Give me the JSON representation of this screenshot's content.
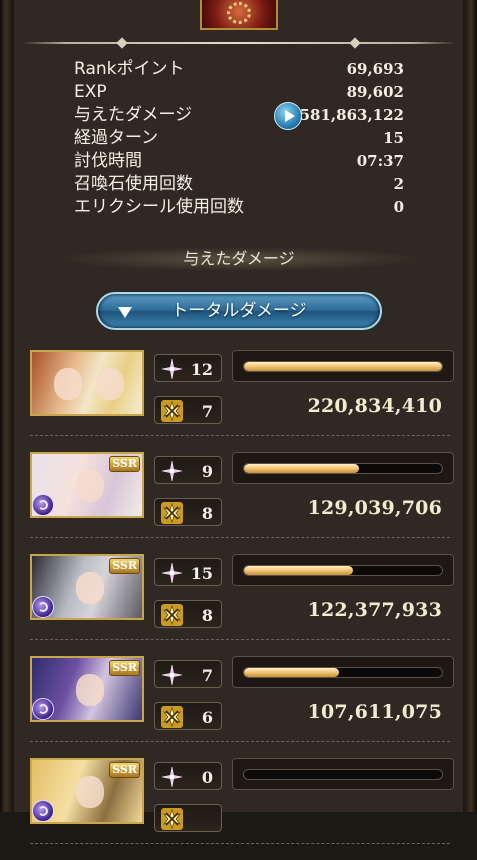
{
  "stats": [
    {
      "label": "Rankポイント",
      "value": "69,693"
    },
    {
      "label": "EXP",
      "value": "89,602"
    },
    {
      "label": "与えたダメージ",
      "value": "581,863,122",
      "icon": "play-icon"
    },
    {
      "label": "経過ターン",
      "value": "15"
    },
    {
      "label": "討伐時間",
      "value": "07:37"
    },
    {
      "label": "召喚石使用回数",
      "value": "2"
    },
    {
      "label": "エリクシール使用回数",
      "value": "0"
    }
  ],
  "section_title": "与えたダメージ",
  "damage_filter": {
    "selected": "トータルダメージ",
    "icon": "triangle-down-icon"
  },
  "ssr_badge": "SSR",
  "characters": [
    {
      "skill_count": "12",
      "ca_count": "7",
      "damage": "220,834,410",
      "gauge": 1.0,
      "ssr": false,
      "element_icon": false
    },
    {
      "skill_count": "9",
      "ca_count": "8",
      "damage": "129,039,706",
      "gauge": 0.58,
      "ssr": true,
      "element_icon": true
    },
    {
      "skill_count": "15",
      "ca_count": "8",
      "damage": "122,377,933",
      "gauge": 0.55,
      "ssr": true,
      "element_icon": true
    },
    {
      "skill_count": "7",
      "ca_count": "6",
      "damage": "107,611,075",
      "gauge": 0.48,
      "ssr": true,
      "element_icon": true
    },
    {
      "skill_count": "0",
      "ca_count": "",
      "damage": "",
      "gauge": 0.0,
      "ssr": true,
      "element_icon": true
    }
  ],
  "colors": {
    "gauge_fill": "#f3c77a",
    "button": "#2c6a95",
    "panel": "#302923"
  }
}
